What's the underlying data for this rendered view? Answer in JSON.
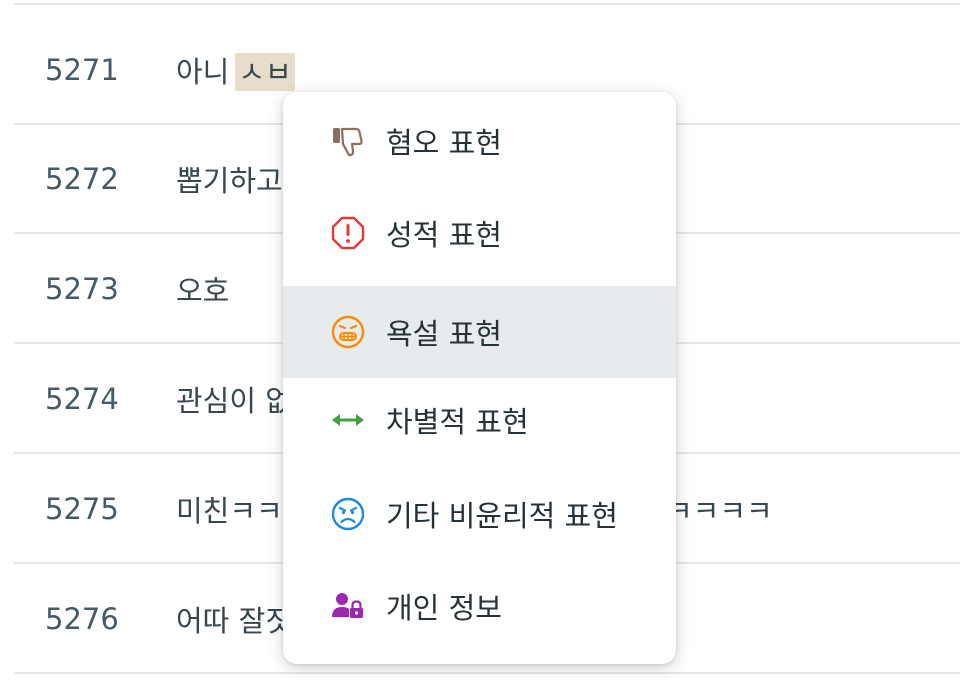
{
  "rows": [
    {
      "id": "5271",
      "text": "아니",
      "highlight": "ㅅㅂ"
    },
    {
      "id": "5272",
      "text": "뽑기하고"
    },
    {
      "id": "5273",
      "text": "오호"
    },
    {
      "id": "5274",
      "text": "관심이 없"
    },
    {
      "id": "5275",
      "text": "미친ㅋㅋ",
      "tail": "ㅋㅋㅋㅋ"
    },
    {
      "id": "5276",
      "text": "어따 잘짓"
    }
  ],
  "menu": {
    "items": [
      {
        "label": "혐오 표현",
        "icon": "thumbs-down-icon",
        "color": "#8d6e63"
      },
      {
        "label": "성적 표현",
        "icon": "octagon-alert-icon",
        "color": "#e53935"
      },
      {
        "label": "욕설 표현",
        "icon": "grimace-face-icon",
        "color": "#fb8c00",
        "active": true
      },
      {
        "label": "차별적 표현",
        "icon": "double-arrow-icon",
        "color": "#43a047"
      },
      {
        "label": "기타 비윤리적 표현",
        "icon": "sad-face-icon",
        "color": "#1e88e5"
      },
      {
        "label": "개인 정보",
        "icon": "user-lock-icon",
        "color": "#9c27b0"
      }
    ]
  }
}
